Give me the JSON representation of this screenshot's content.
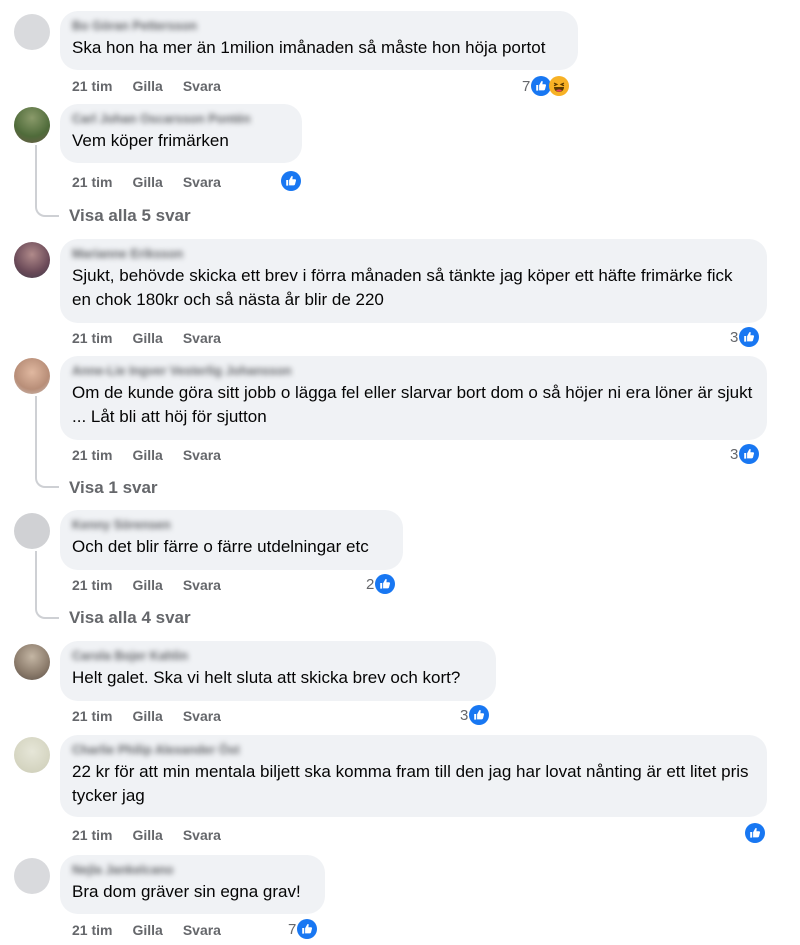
{
  "colors": {
    "bubble": "#f0f2f5",
    "meta_text": "#65676b",
    "like_blue": "#1877f2",
    "thread_line": "#ced0d4"
  },
  "comments": [
    {
      "author": "Bo Göran Pettersson",
      "text": "Ska hon ha mer än 1milion imånaden så måste hon höja portot",
      "time": "21 tim",
      "like": "Gilla",
      "reply": "Svara",
      "reaction_count": "7",
      "reaction_icons": [
        "like-icon",
        "haha-icon"
      ]
    },
    {
      "author": "Carl Johan Oscarsson Pontén",
      "text": "Vem köper frimärken",
      "time": "21 tim",
      "like": "Gilla",
      "reply": "Svara",
      "reaction_count": "",
      "reaction_icons": [
        "like-icon"
      ],
      "view_replies": "Visa alla 5 svar"
    },
    {
      "author": "Marianne Eriksson",
      "text": "Sjukt, behövde skicka ett brev i förra månaden så tänkte jag köper ett häfte frimärke fick en chok 180kr och så nästa år blir de 220",
      "time": "21 tim",
      "like": "Gilla",
      "reply": "Svara",
      "reaction_count": "3",
      "reaction_icons": [
        "like-icon"
      ]
    },
    {
      "author": "Anne-Lie Ingver Vesterlig Johansson",
      "text": "Om de kunde göra sitt jobb o lägga fel eller slarvar bort dom o så höjer ni era löner är sjukt ... Låt bli att höj för sjutton",
      "time": "21 tim",
      "like": "Gilla",
      "reply": "Svara",
      "reaction_count": "3",
      "reaction_icons": [
        "like-icon"
      ],
      "view_replies": "Visa 1 svar"
    },
    {
      "author": "Kenny Sörensen",
      "text": "Och det blir färre o färre utdelningar etc",
      "time": "21 tim",
      "like": "Gilla",
      "reply": "Svara",
      "reaction_count": "2",
      "reaction_icons": [
        "like-icon"
      ],
      "view_replies": "Visa alla 4 svar"
    },
    {
      "author": "Carola Bojer Kahlin",
      "text": "Helt galet. Ska vi helt sluta att skicka brev och kort?",
      "time": "21 tim",
      "like": "Gilla",
      "reply": "Svara",
      "reaction_count": "3",
      "reaction_icons": [
        "like-icon"
      ]
    },
    {
      "author": "Charlie Philip Alexander Öst",
      "text": "22 kr för att min mentala biljett ska komma fram till den jag har lovat nånting är ett litet pris tycker jag",
      "time": "21 tim",
      "like": "Gilla",
      "reply": "Svara",
      "reaction_count": "",
      "reaction_icons": [
        "like-icon"
      ]
    },
    {
      "author": "Nejla Jankelcano",
      "text": "Bra dom gräver sin egna grav!",
      "time": "21 tim",
      "like": "Gilla",
      "reply": "Svara",
      "reaction_count": "7",
      "reaction_icons": [
        "like-icon"
      ]
    }
  ]
}
